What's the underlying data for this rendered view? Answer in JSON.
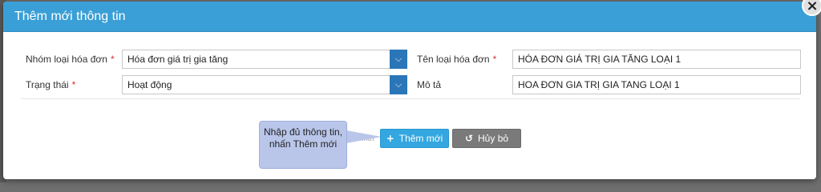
{
  "modal": {
    "title": "Thêm mới thông tin",
    "close_glyph": "×"
  },
  "form": {
    "invoice_group_label": "Nhóm loại hóa đơn",
    "invoice_group_value": "Hóa đơn giá trị gia tăng",
    "invoice_type_name_label": "Tên loại hóa đơn",
    "invoice_type_name_value": "HÓA ĐƠN GIÁ TRỊ GIA TĂNG LOẠI 1",
    "status_label": "Trạng thái",
    "status_value": "Hoạt động",
    "description_label": "Mô tả",
    "description_value": "HOA ĐƠN GIA TRỊ GIA TANG LOẠI 1",
    "required_mark": "*"
  },
  "actions": {
    "add_label": "Thêm mới",
    "add_icon": "plus-icon",
    "cancel_label": "Hủy bỏ",
    "cancel_icon": "undo-icon"
  },
  "tooltip": {
    "text": "Nhập đủ thông tin, nhấn Thêm mới"
  },
  "ghost_text": "mới",
  "colors": {
    "header": "#3a9fd6",
    "select_arrow": "#2a76b8",
    "add_button": "#34a7e0",
    "cancel_button": "#7a7a7a",
    "tooltip": "#b9c6ea",
    "required": "#d9302c"
  }
}
